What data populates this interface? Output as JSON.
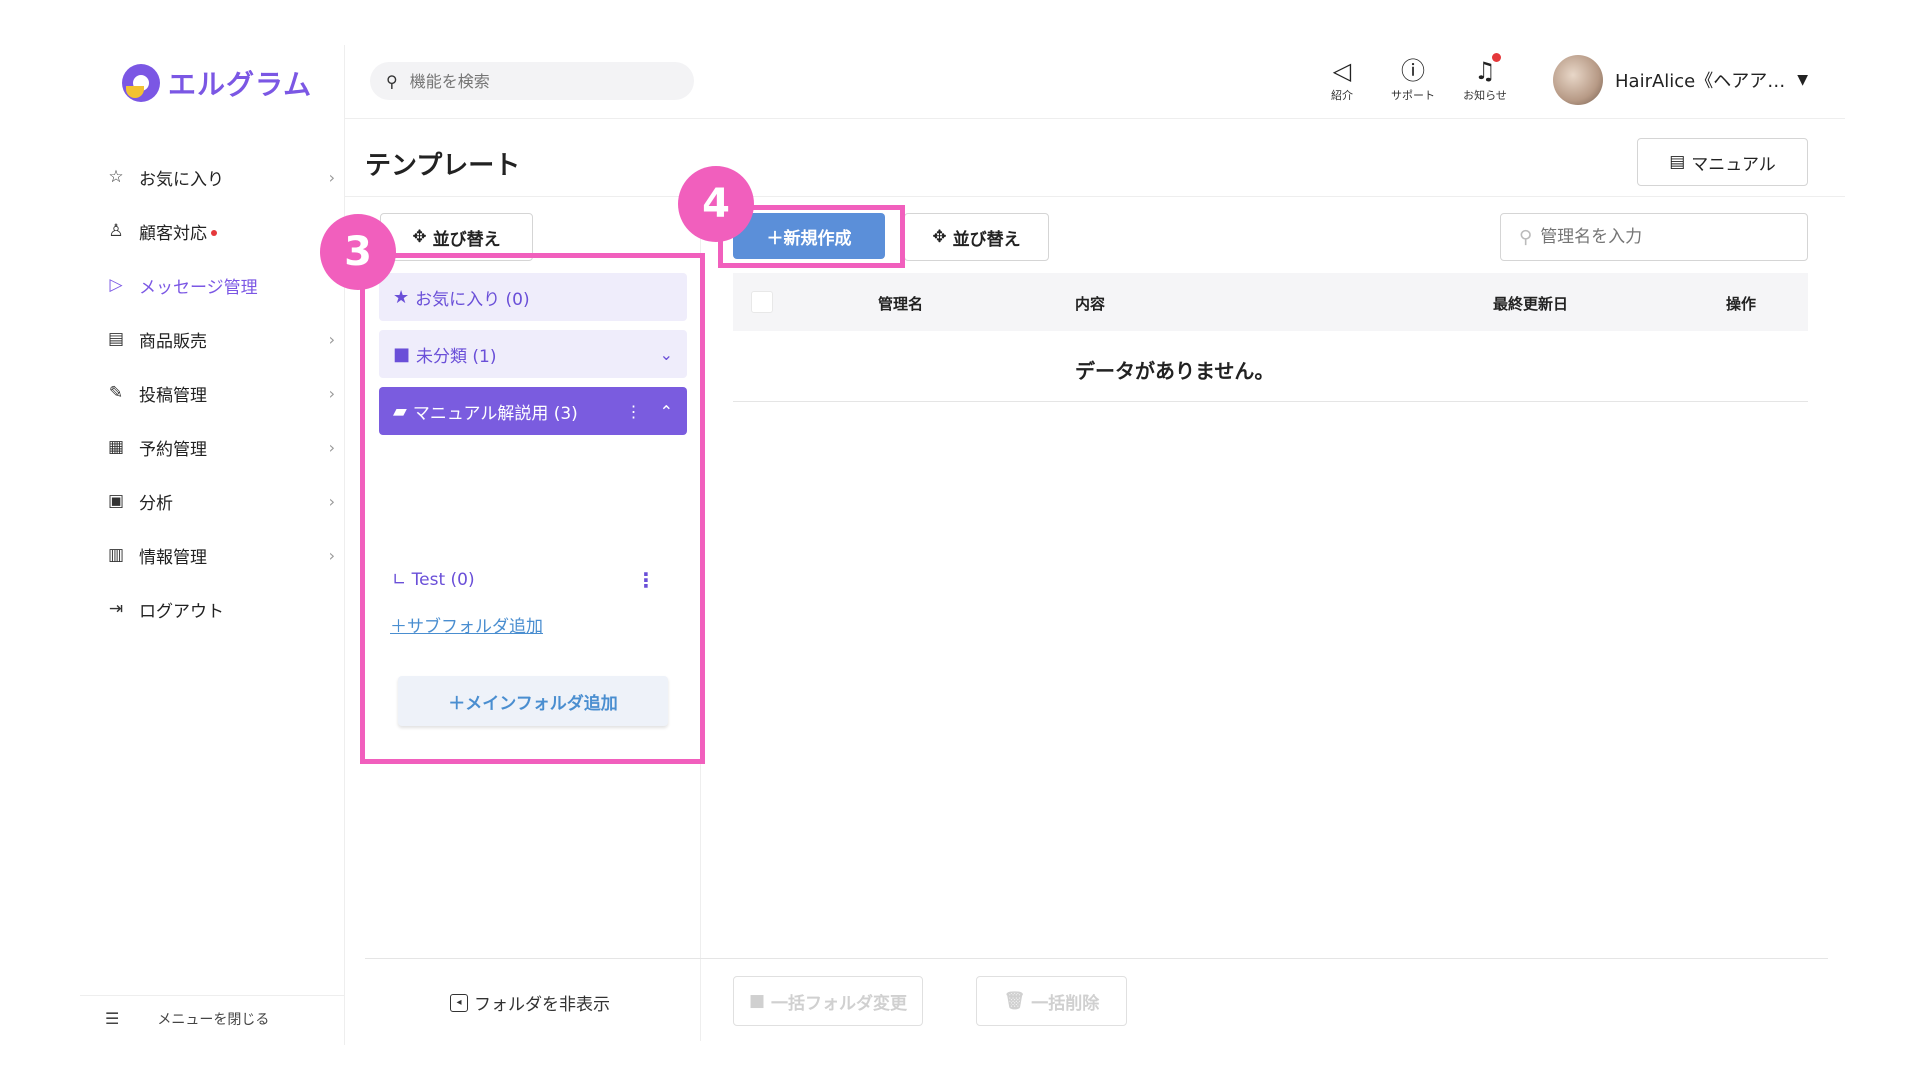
{
  "app": {
    "logo_text": "エルグラム"
  },
  "sidebar": {
    "items": [
      {
        "label": "お気に入り",
        "icon": "star-icon"
      },
      {
        "label": "顧客対応",
        "icon": "user-icon"
      },
      {
        "label": "メッセージ管理",
        "icon": "send-icon"
      },
      {
        "label": "商品販売",
        "icon": "register-icon"
      },
      {
        "label": "投稿管理",
        "icon": "edit-icon"
      },
      {
        "label": "予約管理",
        "icon": "calendar-icon"
      },
      {
        "label": "分析",
        "icon": "report-icon"
      },
      {
        "label": "情報管理",
        "icon": "bar-chart-icon"
      },
      {
        "label": "ログアウト",
        "icon": "logout-icon"
      }
    ],
    "close_menu": "メニューを閉じる"
  },
  "header": {
    "search_placeholder": "機能を検索",
    "icons": [
      {
        "label": "紹介",
        "icon": "megaphone-icon"
      },
      {
        "label": "サポート",
        "icon": "help-icon"
      },
      {
        "label": "お知らせ",
        "icon": "bell-icon"
      }
    ],
    "user_name": "HairAlice《ヘアア…"
  },
  "page": {
    "title": "テンプレート",
    "manual_label": "マニュアル"
  },
  "folders": {
    "sort_label": "並び替え",
    "favorites": "お気に入り (0)",
    "uncategorized": "未分類 (1)",
    "manual": "マニュアル解説用 (3)",
    "sub_test": "∟ Test (0)",
    "add_sub": "＋サブフォルダ追加",
    "add_main": "＋メインフォルダ追加",
    "hide": "フォルダを非表示"
  },
  "content": {
    "new_label": "＋新規作成",
    "sort_label": "並び替え",
    "search_placeholder": "管理名を入力",
    "columns": {
      "name": "管理名",
      "content": "内容",
      "updated": "最終更新日",
      "actions": "操作"
    },
    "empty": "データがありません。",
    "bulk_folder": "一括フォルダ変更",
    "bulk_delete": "一括削除"
  },
  "annotations": {
    "step3": "3",
    "step4": "4"
  },
  "colors": {
    "accent": "#7b57e4",
    "primary_button": "#5b8fd9",
    "highlight": "#f15fbd"
  }
}
